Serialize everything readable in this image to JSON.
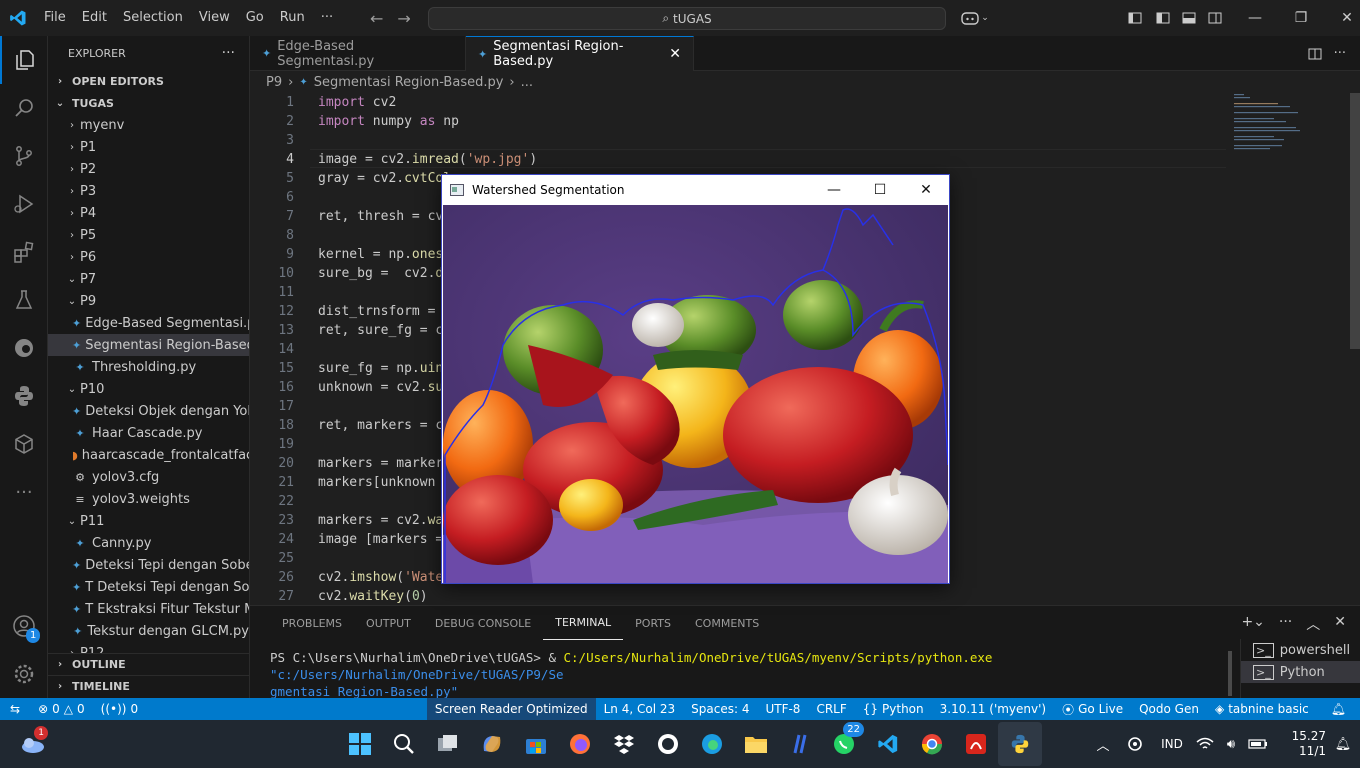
{
  "titlebar": {
    "menu": [
      "File",
      "Edit",
      "Selection",
      "View",
      "Go",
      "Run",
      "···"
    ],
    "search": "tUGAS"
  },
  "sidebar": {
    "header": "EXPLORER",
    "open_editors": "OPEN EDITORS",
    "root": "TUGAS",
    "items": [
      {
        "label": "myenv",
        "type": "folder",
        "indent": 1,
        "open": false
      },
      {
        "label": "P1",
        "type": "folder",
        "indent": 1,
        "open": false
      },
      {
        "label": "P2",
        "type": "folder",
        "indent": 1,
        "open": false
      },
      {
        "label": "P3",
        "type": "folder",
        "indent": 1,
        "open": false
      },
      {
        "label": "P4",
        "type": "folder",
        "indent": 1,
        "open": false
      },
      {
        "label": "P5",
        "type": "folder",
        "indent": 1,
        "open": false
      },
      {
        "label": "P6",
        "type": "folder",
        "indent": 1,
        "open": false
      },
      {
        "label": "P7",
        "type": "folder",
        "indent": 1,
        "open": true
      },
      {
        "label": "P9",
        "type": "folder",
        "indent": 1,
        "open": true
      },
      {
        "label": "Edge-Based Segmentasi.py",
        "type": "py",
        "indent": 2
      },
      {
        "label": "Segmentasi Region-Based...",
        "type": "py",
        "indent": 2,
        "selected": true
      },
      {
        "label": "Thresholding.py",
        "type": "py",
        "indent": 2
      },
      {
        "label": "P10",
        "type": "folder",
        "indent": 1,
        "open": true
      },
      {
        "label": "Deteksi Objek dengan Yol...",
        "type": "py",
        "indent": 2
      },
      {
        "label": "Haar Cascade.py",
        "type": "py",
        "indent": 2
      },
      {
        "label": "haarcascade_frontalcatfac...",
        "type": "rss",
        "indent": 2
      },
      {
        "label": "yolov3.cfg",
        "type": "gear",
        "indent": 2
      },
      {
        "label": "yolov3.weights",
        "type": "file",
        "indent": 2
      },
      {
        "label": "P11",
        "type": "folder",
        "indent": 1,
        "open": true
      },
      {
        "label": "Canny.py",
        "type": "py",
        "indent": 2
      },
      {
        "label": "Deteksi Tepi dengan Sobe...",
        "type": "py",
        "indent": 2
      },
      {
        "label": "T Deteksi Tepi dengan So...",
        "type": "py",
        "indent": 2
      },
      {
        "label": "T Ekstraksi Fitur Tekstur M...",
        "type": "py",
        "indent": 2
      },
      {
        "label": "Tekstur dengan GLCM.py",
        "type": "py",
        "indent": 2
      },
      {
        "label": "P12",
        "type": "folder",
        "indent": 1,
        "open": false
      }
    ],
    "outline": "OUTLINE",
    "timeline": "TIMELINE"
  },
  "tabs": [
    {
      "label": "Edge-Based Segmentasi.py",
      "active": false
    },
    {
      "label": "Segmentasi Region-Based.py",
      "active": true
    }
  ],
  "breadcrumb": [
    "P9",
    "Segmentasi Region-Based.py",
    "..."
  ],
  "code": {
    "current_line": 4,
    "lines": [
      {
        "n": "1",
        "html": "<span class='kw'>import</span> cv2"
      },
      {
        "n": "2",
        "html": "<span class='kw'>import</span> numpy <span class='kw'>as</span> np"
      },
      {
        "n": "3",
        "html": ""
      },
      {
        "n": "4",
        "html": "image = cv2.<span class='fn'>imread</span>(<span class='str'>'wp.jpg'</span>)"
      },
      {
        "n": "5",
        "html": "gray = cv2.<span class='fn'>cvtCol</span>"
      },
      {
        "n": "6",
        "html": ""
      },
      {
        "n": "7",
        "html": "ret, thresh = cv"
      },
      {
        "n": "8",
        "html": ""
      },
      {
        "n": "9",
        "html": "kernel = np.<span class='fn'>ones</span>"
      },
      {
        "n": "10",
        "html": "sure_bg =  cv2.<span class='fn'>d</span>"
      },
      {
        "n": "11",
        "html": ""
      },
      {
        "n": "12",
        "html": "dist_trnsform = "
      },
      {
        "n": "13",
        "html": "ret, sure_fg = c"
      },
      {
        "n": "14",
        "html": ""
      },
      {
        "n": "15",
        "html": "sure_fg = np.<span class='fn'>uin</span>"
      },
      {
        "n": "16",
        "html": "unknown = cv2.<span class='fn'>su</span>"
      },
      {
        "n": "17",
        "html": ""
      },
      {
        "n": "18",
        "html": "ret, markers = c"
      },
      {
        "n": "19",
        "html": ""
      },
      {
        "n": "20",
        "html": "markers = marker"
      },
      {
        "n": "21",
        "html": "markers[unknown "
      },
      {
        "n": "22",
        "html": ""
      },
      {
        "n": "23",
        "html": "markers = cv2.<span class='fn'>wa</span>"
      },
      {
        "n": "24",
        "html": "image [markers ="
      },
      {
        "n": "25",
        "html": ""
      },
      {
        "n": "26",
        "html": "cv2.<span class='fn'>imshow</span>(<span class='str'>'Wate</span>"
      },
      {
        "n": "27",
        "html": "cv2.<span class='fn'>waitKey</span>(<span class='num'>0</span>)"
      }
    ]
  },
  "panel": {
    "tabs": [
      "PROBLEMS",
      "OUTPUT",
      "DEBUG CONSOLE",
      "TERMINAL",
      "PORTS",
      "COMMENTS"
    ],
    "active_tab": "TERMINAL",
    "prompt": "PS C:\\Users\\Nurhalim\\OneDrive\\tUGAS> & ",
    "exe": "C:/Users/Nurhalim/OneDrive/tUGAS/myenv/Scripts/python.exe",
    "arg1": " \"c:/Users/Nurhalim/OneDrive/tUGAS/P9/Se",
    "arg2": "gmentasi Region-Based.py\"",
    "terminals": [
      "powershell",
      "Python"
    ]
  },
  "popup": {
    "title": "Watershed Segmentation"
  },
  "status": {
    "errors": "0",
    "warnings": "0",
    "ports": "0",
    "screen_reader": "Screen Reader Optimized",
    "position": "Ln 4, Col 23",
    "spaces": "Spaces: 4",
    "encoding": "UTF-8",
    "eol": "CRLF",
    "language": "Python",
    "interpreter": "3.10.11 ('myenv')",
    "golive": "Go Live",
    "qodo": "Qodo Gen",
    "tabnine": "tabnine basic"
  },
  "taskbar": {
    "weather_badge": "1",
    "whatsapp_badge": "22",
    "account_badge": "1",
    "lang": "IND",
    "time": "15.27",
    "date": "11/1"
  }
}
